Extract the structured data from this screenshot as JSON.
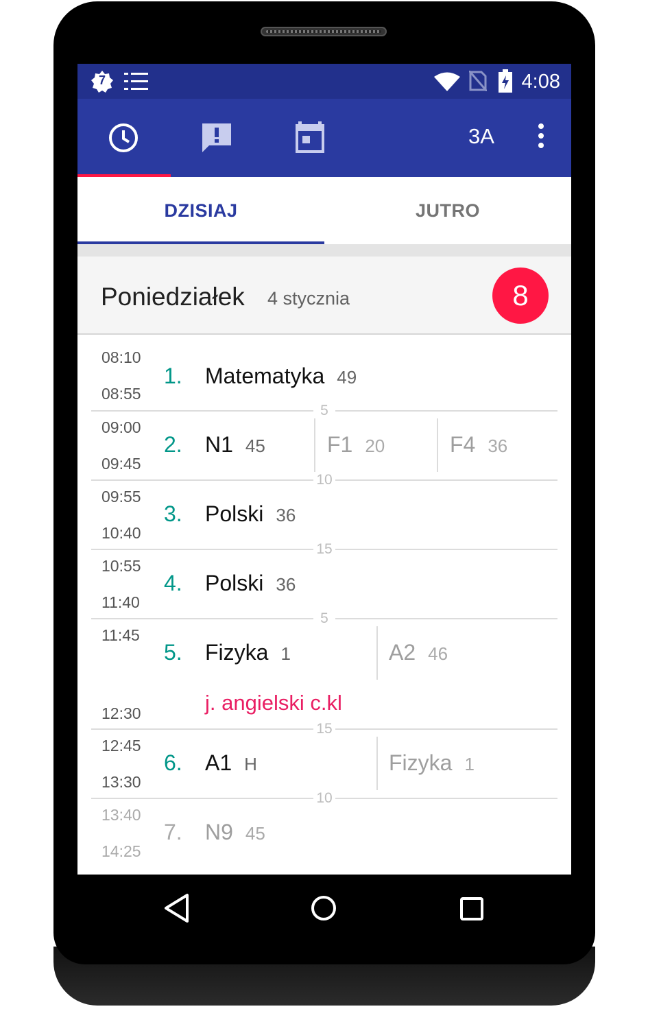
{
  "status_bar": {
    "time": "4:08",
    "left_icons": [
      "notification-badge-7-icon",
      "checklist-icon"
    ],
    "notification_badge_text": "7",
    "right_icons": [
      "wifi-icon",
      "no-sim-icon",
      "battery-charging-icon"
    ]
  },
  "app_bar": {
    "icons": [
      "clock-icon",
      "announcement-icon",
      "calendar-icon"
    ],
    "class_label": "3A",
    "menu_icon": "more-vert-icon",
    "accent_color": "#ff1744",
    "primary_color": "#2a3aa0"
  },
  "tabs": [
    {
      "label": "DZISIAJ",
      "active": true
    },
    {
      "label": "JUTRO",
      "active": false
    }
  ],
  "day": {
    "name": "Poniedziałek",
    "date": "4 stycznia",
    "lesson_count": "8"
  },
  "lessons": [
    {
      "number": "1.",
      "start": "08:10",
      "end": "08:55",
      "groups": [
        {
          "subject": "Matematyka",
          "room": "49",
          "dim": false
        }
      ]
    },
    {
      "number": "2.",
      "start": "09:00",
      "end": "09:45",
      "groups": [
        {
          "subject": "N1",
          "room": "45",
          "dim": false
        },
        {
          "subject": "F1",
          "room": "20",
          "dim": true
        },
        {
          "subject": "F4",
          "room": "36",
          "dim": true
        }
      ]
    },
    {
      "number": "3.",
      "start": "09:55",
      "end": "10:40",
      "groups": [
        {
          "subject": "Polski",
          "room": "36",
          "dim": false
        }
      ]
    },
    {
      "number": "4.",
      "start": "10:55",
      "end": "11:40",
      "groups": [
        {
          "subject": "Polski",
          "room": "36",
          "dim": false
        }
      ]
    },
    {
      "number": "5.",
      "start": "11:45",
      "end": "12:30",
      "groups": [
        {
          "subject": "Fizyka",
          "room": "1",
          "dim": false
        },
        {
          "subject": "A2",
          "room": "46",
          "dim": true
        }
      ],
      "event": "j. angielski c.kl"
    },
    {
      "number": "6.",
      "start": "12:45",
      "end": "13:30",
      "groups": [
        {
          "subject": "A1",
          "room": "H",
          "dim": false
        },
        {
          "subject": "Fizyka",
          "room": "1",
          "dim": true
        }
      ]
    },
    {
      "number": "7.",
      "start": "13:40",
      "end": "14:25",
      "past": true,
      "groups": [
        {
          "subject": "N9",
          "room": "45",
          "dim": true
        }
      ]
    }
  ],
  "breaks": [
    "5",
    "10",
    "15",
    "5",
    "15",
    "10"
  ],
  "nav_bar": [
    "back-icon",
    "home-icon",
    "recents-icon"
  ]
}
